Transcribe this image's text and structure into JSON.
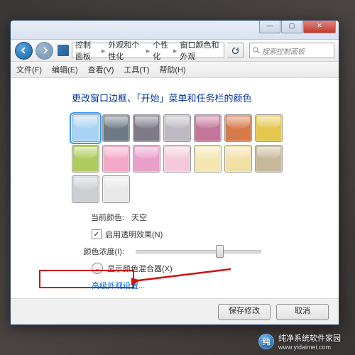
{
  "win": {
    "min": "—",
    "max": "▢",
    "close": "✕"
  },
  "breadcrumb": {
    "a": "控制面板",
    "b": "外观和个性化",
    "c": "个性化",
    "d": "窗口颜色和外观"
  },
  "search": {
    "placeholder": "搜索控制面板"
  },
  "menu": {
    "file": "文件(F)",
    "edit": "编辑(E)",
    "view": "查看(V)",
    "tools": "工具(T)",
    "help": "帮助(H)"
  },
  "heading": "更改窗口边框、「开始」菜单和任务栏的颜色",
  "swatches": [
    "#a9d3f2",
    "#6e7a85",
    "#7e7a87",
    "#bdb8c2",
    "#c3769a",
    "#d77a4a",
    "#e3c74e",
    "#aecb5e",
    "#f5a7c7",
    "#e8a0c8",
    "#f4c9d9",
    "#f3e6af",
    "#f1e0a6",
    "#c7b899",
    "#cbcfd4",
    "#e8e8e8"
  ],
  "current": {
    "lbl": "当前颜色:",
    "name": "天空"
  },
  "trans": {
    "text": "启用透明效果(N)",
    "checked": true
  },
  "intensity": {
    "lbl": "颜色浓度(I):"
  },
  "mixer": {
    "text": "显示颜色混合器(X)"
  },
  "advanced": {
    "text": "高级外观设置..."
  },
  "buttons": {
    "save": "保存修改",
    "cancel": "取消"
  },
  "wm": {
    "title": "纯净系统软件家园",
    "url": "www.yidaimei.com"
  }
}
